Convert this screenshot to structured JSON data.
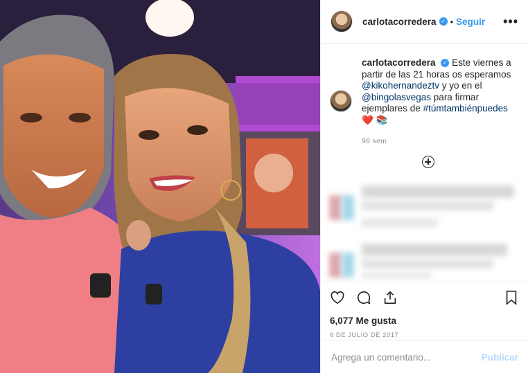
{
  "post": {
    "photo_icon": "selfie-photo"
  },
  "header": {
    "username": "carlotacorredera",
    "verified_icon": "verified-badge-icon",
    "separator": "•",
    "follow_label": "Seguir",
    "more_label": "•••"
  },
  "caption": {
    "username": "carlotacorredera",
    "text_1": "Este viernes a partir de las 21 horas os esperamos",
    "mention_1": "@kikohernandeztv",
    "text_2": "y yo en el",
    "mention_2": "@bingolasvegas",
    "text_3": "para firmar ejemplares de",
    "hashtag": "#túmtambiénpuedes",
    "emoji": "❤️ 📚",
    "time": "96 sem"
  },
  "actions": {
    "likes": "6,077 Me gusta",
    "date": "6 DE JULIO DE 2017"
  },
  "comment": {
    "placeholder": "Agrega un comentario...",
    "publish_label": "Publicar"
  },
  "colors": {
    "accent": "#3897f0",
    "link": "#003569",
    "muted": "#8e8e8e"
  }
}
